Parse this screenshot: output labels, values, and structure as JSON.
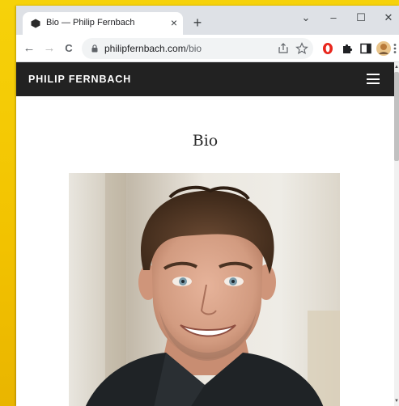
{
  "browser": {
    "tab": {
      "title": "Bio — Philip Fernbach",
      "close_glyph": "×"
    },
    "new_tab_glyph": "+",
    "window_controls": {
      "dropdown": "⌄",
      "minimize": "–",
      "maximize": "☐",
      "close": "✕"
    },
    "nav": {
      "back": "←",
      "forward": "→",
      "reload": "C"
    },
    "address": {
      "domain": "philipfernbach.com",
      "path": "/bio"
    },
    "icons": {
      "share": "share-icon",
      "bookmark": "star-icon",
      "opera": "opera-extension-icon",
      "extensions": "puzzle-icon",
      "sidebar": "side-panel-icon",
      "profile": "profile-avatar",
      "menu": "kebab-menu-icon"
    }
  },
  "site": {
    "name": "PHILIP FERNBACH",
    "page_title": "Bio",
    "colors": {
      "header_bg": "#222222",
      "header_text": "#ffffff"
    }
  }
}
